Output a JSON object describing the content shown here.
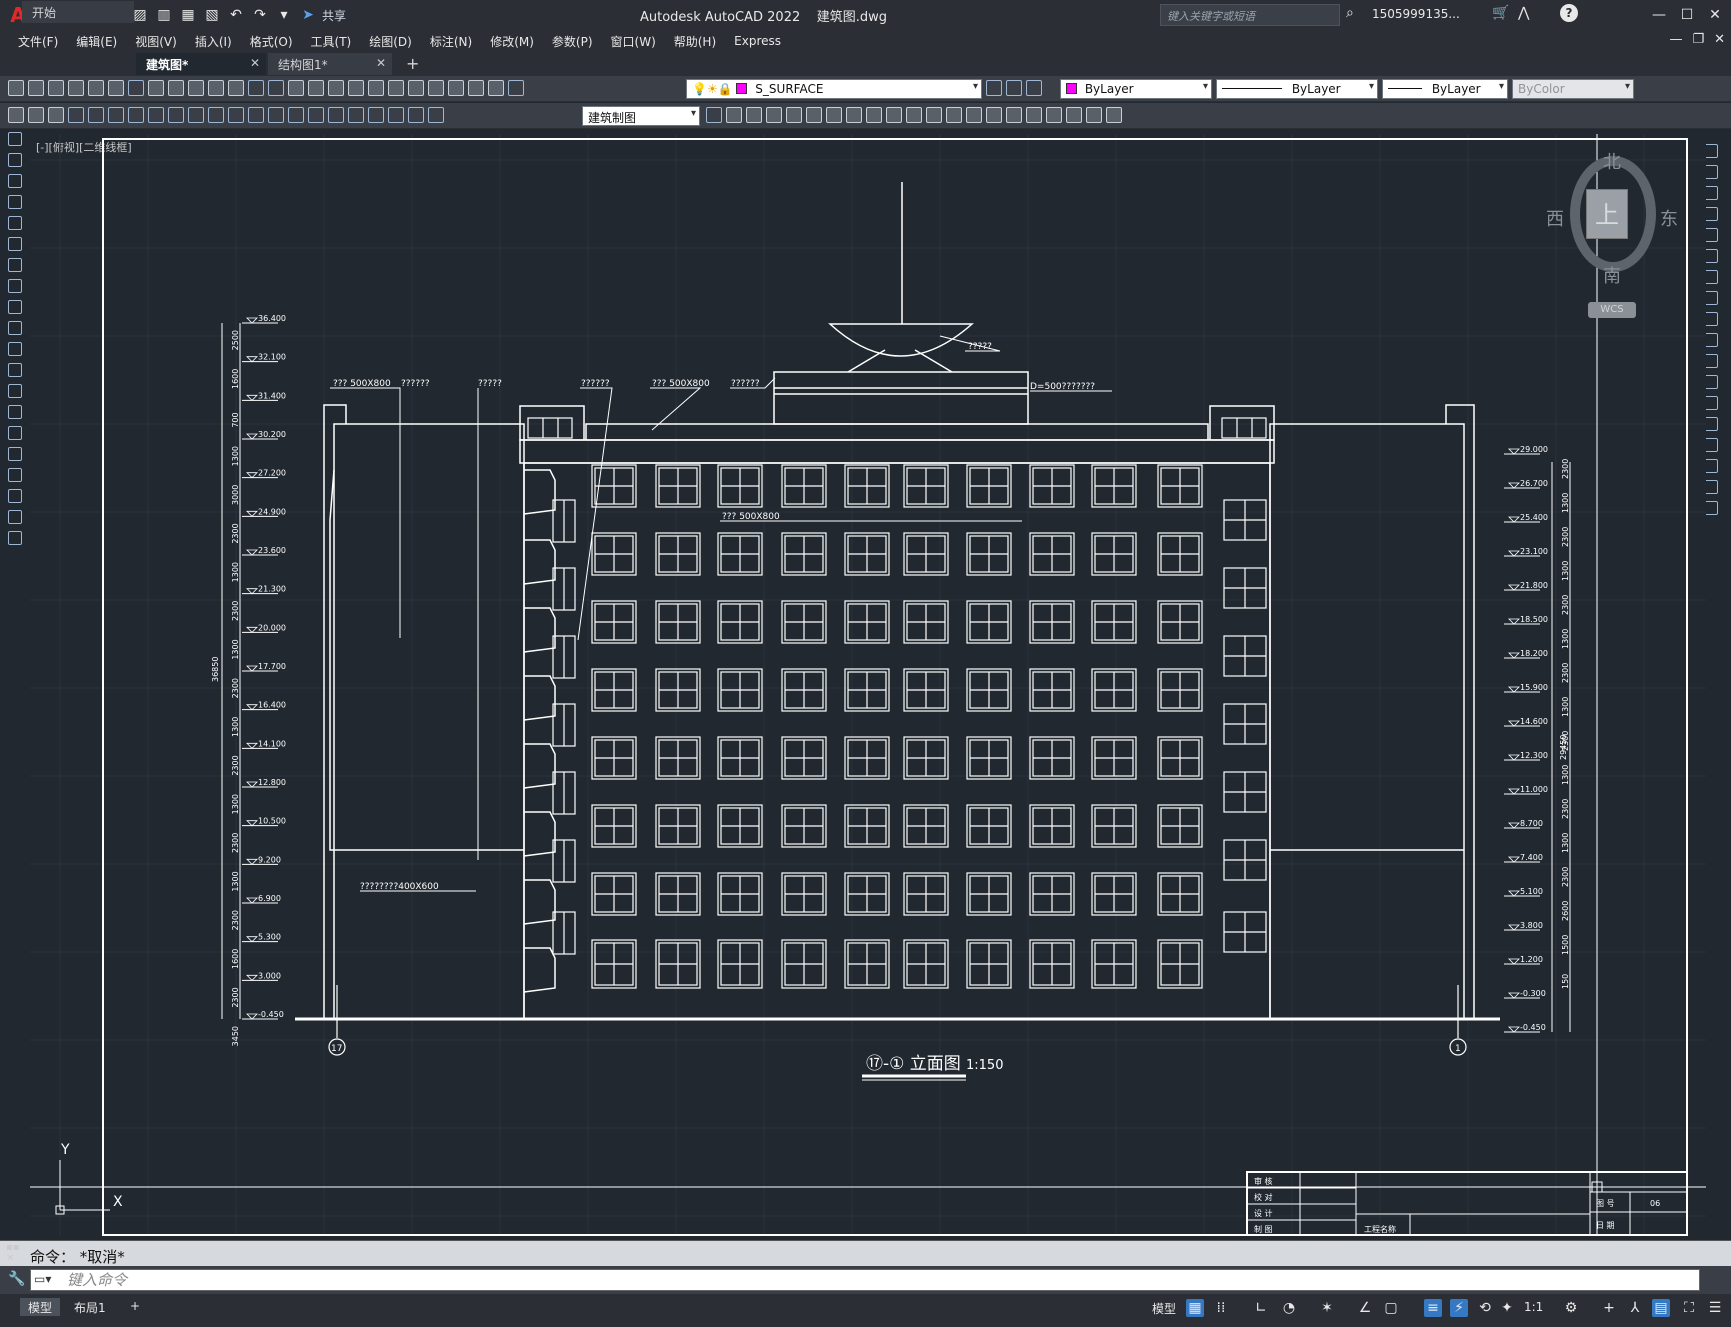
{
  "titlebar": {
    "logo": "A",
    "share_label": "共享",
    "window_title": "Autodesk AutoCAD 2022    建筑图.dwg",
    "search_placeholder": "键入关键字或短语",
    "user": "1505999135...",
    "window_controls": [
      "—",
      "☐",
      "✕"
    ]
  },
  "menus": [
    "文件(F)",
    "编辑(E)",
    "视图(V)",
    "插入(I)",
    "格式(O)",
    "工具(T)",
    "绘图(D)",
    "标注(N)",
    "修改(M)",
    "参数(P)",
    "窗口(W)",
    "帮助(H)",
    "Express"
  ],
  "tabs": [
    {
      "label": "开始",
      "active": false,
      "closable": false
    },
    {
      "label": "建筑图*",
      "active": true,
      "closable": true
    },
    {
      "label": "结构图1*",
      "active": false,
      "closable": true
    }
  ],
  "properties": {
    "layer": "S_SURFACE",
    "color": "ByLayer",
    "linetype": "ByLayer",
    "lineweight": "ByLayer",
    "plotstyle": "ByColor",
    "style_combo": "建筑制图",
    "layer_color": "#ff00ff"
  },
  "viewport": {
    "label": "[-][俯视][二维线框]"
  },
  "viewcube": {
    "north": "北",
    "south": "南",
    "east": "东",
    "west": "西",
    "top": "上",
    "wcs": "WCS"
  },
  "drawing": {
    "title": "⑰-① 立面图",
    "scale": "1:150",
    "axis_left": "17",
    "axis_right": "1",
    "total_height_left": "36850",
    "total_height_right": "29450",
    "notes": {
      "note1": "??? 500X800",
      "note2": "??????",
      "note3": "?????",
      "note4": "??????",
      "note5": "??? 500X800",
      "note6": "??????",
      "note7": "D=500???????",
      "note8": "?????",
      "note9": "???  500X800",
      "note10": "????????400X600"
    },
    "left_elevations": [
      "36.400",
      "32.100",
      "31.400",
      "30.200",
      "27.200",
      "24.900",
      "23.600",
      "21.300",
      "20.000",
      "17.700",
      "16.400",
      "14.100",
      "12.800",
      "10.500",
      "9.200",
      "6.900",
      "5.300",
      "3.000",
      "-0.450"
    ],
    "left_dims": [
      "2500",
      "1600",
      "700",
      "1300",
      "3000",
      "2300",
      "1300",
      "2300",
      "1300",
      "2300",
      "1300",
      "2300",
      "1300",
      "2300",
      "1300",
      "2300",
      "1600",
      "2300",
      "3450"
    ],
    "right_elevations": [
      "29.000",
      "26.700",
      "25.400",
      "23.100",
      "21.800",
      "18.500",
      "18.200",
      "15.900",
      "14.600",
      "12.300",
      "11.000",
      "8.700",
      "7.400",
      "5.100",
      "3.800",
      "1.200",
      "-0.300",
      "-0.450"
    ],
    "right_dims": [
      "2300",
      "1300",
      "2300",
      "1300",
      "2300",
      "1300",
      "2300",
      "1300",
      "2300",
      "1300",
      "2300",
      "1300",
      "2300",
      "2600",
      "1500",
      "150"
    ],
    "titleblock": {
      "rows": [
        "审 核",
        "校 对",
        "设 计",
        "制 图"
      ],
      "project": "工程名称",
      "sheet_label": "图 号",
      "sheet_no": "06",
      "date_label": "日 期"
    }
  },
  "command": {
    "history": "命令：  *取消*",
    "placeholder": "键入命令"
  },
  "status": {
    "layouts": [
      "模型",
      "布局1"
    ],
    "model_label": "模型",
    "scale": "1:1"
  }
}
